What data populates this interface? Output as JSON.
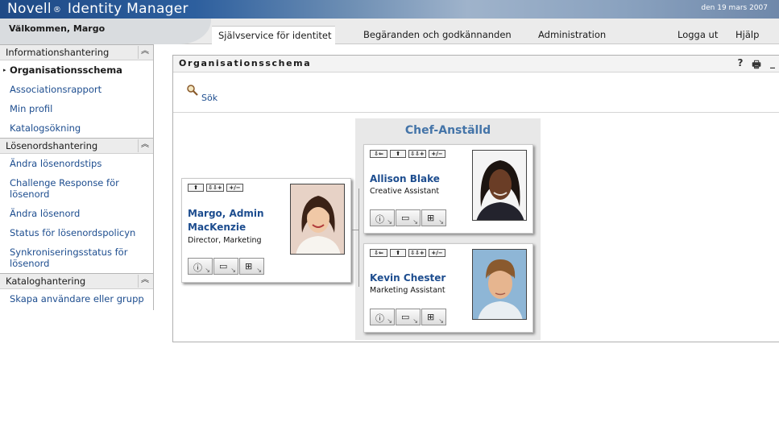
{
  "app": {
    "title_part1": "Novell",
    "title_reg": "®",
    "title_part2": "Identity Manager",
    "date": "den 19 mars 2007"
  },
  "header": {
    "welcome": "Välkommen, Margo",
    "tabs": [
      {
        "label": "Självservice för identitet",
        "active": true
      },
      {
        "label": "Begäranden och godkännanden",
        "active": false
      },
      {
        "label": "Administration",
        "active": false
      }
    ],
    "logout": "Logga ut",
    "help": "Hjälp"
  },
  "sidebar": {
    "sections": [
      {
        "title": "Informationshantering",
        "items": [
          {
            "label": "Organisationsschema",
            "selected": true
          },
          {
            "label": "Associationsrapport"
          },
          {
            "label": "Min profil"
          },
          {
            "label": "Katalogsökning"
          }
        ]
      },
      {
        "title": "Lösenordshantering",
        "items": [
          {
            "label": "Ändra lösenordstips"
          },
          {
            "label": "Challenge Response för lösenord"
          },
          {
            "label": "Ändra lösenord"
          },
          {
            "label": "Status för lösenordspolicyn"
          },
          {
            "label": "Synkroniseringsstatus för lösenord"
          }
        ]
      },
      {
        "title": "Kataloghantering",
        "items": [
          {
            "label": "Skapa användare eller grupp"
          }
        ]
      }
    ]
  },
  "portlet": {
    "title": "Organisationsschema",
    "tools": [
      "?",
      "🖶",
      "_"
    ],
    "search_label": "Sök",
    "group_title": "Chef-Anställd",
    "mini_toolbar": [
      "⇩⇐",
      "⬆",
      "⇩⇩+",
      "+/−"
    ],
    "people": {
      "manager": {
        "name": "Margo, Admin MacKenzie",
        "title": "Director, Marketing"
      },
      "report1": {
        "name": "Allison Blake",
        "title": "Creative Assistant"
      },
      "report2": {
        "name": "Kevin Chester",
        "title": "Marketing Assistant"
      }
    }
  }
}
